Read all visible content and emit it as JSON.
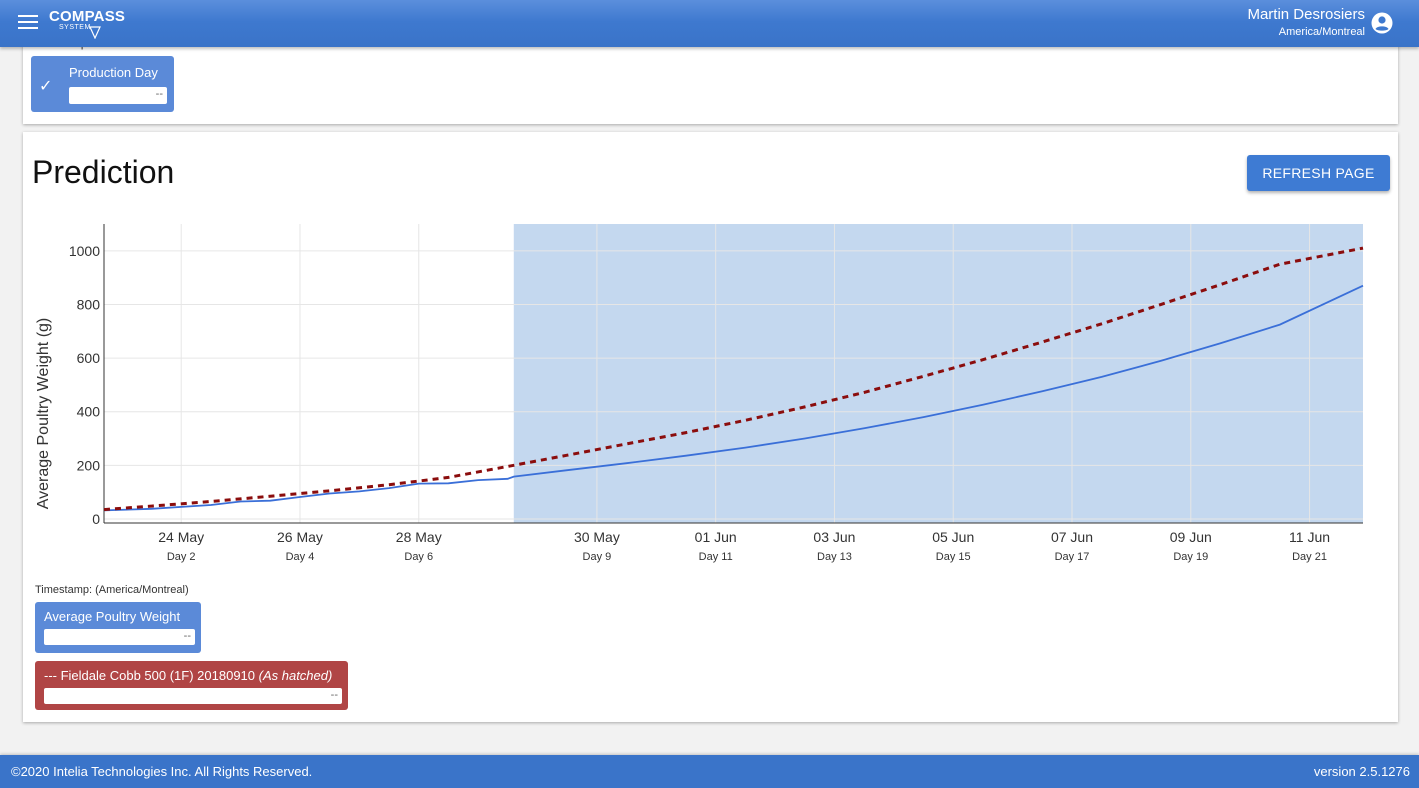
{
  "header": {
    "logo_text": "COMPASS",
    "logo_sub": "SYSTEM",
    "user_name": "Martin Desrosiers",
    "user_timezone": "America/Montreal",
    "brand_color": "#3e79cf"
  },
  "top_card": {
    "timestamp_label_cut": "Timestamp:",
    "production_day_label": "Production Day",
    "production_day_value": "--",
    "checked": true
  },
  "prediction": {
    "title": "Prediction",
    "refresh_label": "REFRESH PAGE",
    "timestamp_label": "Timestamp: (America/Montreal)",
    "legend_blue_label": "Average Poultry Weight",
    "legend_blue_value": "--",
    "legend_red_label": "--- Fieldale Cobb 500 (1F) 20180910 ",
    "legend_red_italic": "(As hatched)",
    "legend_red_value": "--"
  },
  "chart_data": {
    "type": "line",
    "ylabel": "Average Poultry Weight (g)",
    "yticks": [
      0,
      200,
      400,
      600,
      800,
      1000
    ],
    "ylim": [
      -15,
      1100
    ],
    "xlim": [
      0.7,
      21.9
    ],
    "x_ticks": [
      {
        "day": 2,
        "date": "24 May",
        "label": "Day 2"
      },
      {
        "day": 4,
        "date": "26 May",
        "label": "Day 4"
      },
      {
        "day": 6,
        "date": "28 May",
        "label": "Day 6"
      },
      {
        "day": 9,
        "date": "30 May",
        "label": "Day 9"
      },
      {
        "day": 11,
        "date": "01 Jun",
        "label": "Day 11"
      },
      {
        "day": 13,
        "date": "03 Jun",
        "label": "Day 13"
      },
      {
        "day": 15,
        "date": "05 Jun",
        "label": "Day 15"
      },
      {
        "day": 17,
        "date": "07 Jun",
        "label": "Day 17"
      },
      {
        "day": 19,
        "date": "09 Jun",
        "label": "Day 19"
      },
      {
        "day": 21,
        "date": "11 Jun",
        "label": "Day 21"
      }
    ],
    "prediction_region": [
      7.6,
      21.9
    ],
    "prediction_region_color": "#c4d8ef",
    "series": [
      {
        "name": "Average Poultry Weight",
        "color": "#3a6fd8",
        "style": "solid",
        "x": [
          0.7,
          1.5,
          2.5,
          3.0,
          3.5,
          4.0,
          4.5,
          5.0,
          5.5,
          6.0,
          6.5,
          7.0,
          7.5,
          7.6,
          8.5,
          9.5,
          10.5,
          11.5,
          12.5,
          13.5,
          14.5,
          15.5,
          16.5,
          17.5,
          18.5,
          19.5,
          20.5,
          21.9
        ],
        "y": [
          32,
          38,
          52,
          65,
          68,
          82,
          95,
          103,
          115,
          132,
          133,
          145,
          150,
          158,
          182,
          208,
          236,
          266,
          300,
          338,
          380,
          426,
          476,
          530,
          590,
          655,
          725,
          870
        ]
      },
      {
        "name": "--- Fieldale Cobb 500 (1F) 20180910 (As hatched)",
        "color": "#8b0d0d",
        "style": "dashed",
        "x": [
          0.7,
          1.5,
          2.5,
          3.5,
          4.5,
          5.5,
          6.5,
          7.6,
          8.5,
          9.5,
          10.5,
          11.5,
          12.5,
          13.5,
          14.5,
          15.5,
          16.5,
          17.5,
          18.5,
          19.5,
          20.5,
          21.9
        ],
        "y": [
          35,
          48,
          65,
          85,
          105,
          128,
          155,
          200,
          238,
          280,
          322,
          368,
          418,
          472,
          532,
          594,
          660,
          728,
          800,
          874,
          950,
          1010
        ]
      }
    ],
    "grid": true
  },
  "footer": {
    "copyright": "©2020 Intelia Technologies Inc. All Rights Reserved.",
    "version": "version 2.5.1276"
  }
}
